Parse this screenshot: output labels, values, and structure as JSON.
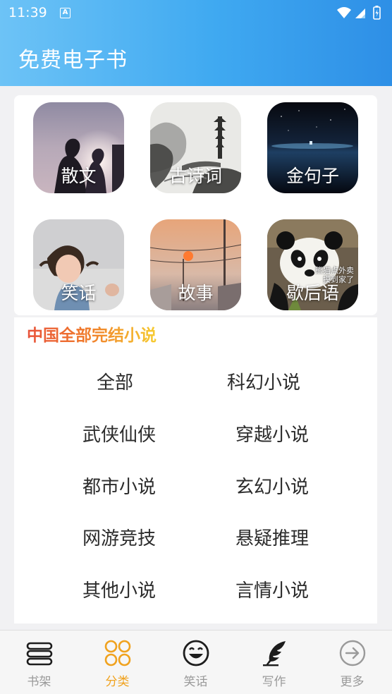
{
  "status_bar": {
    "time": "11:39",
    "notification_icon": "A"
  },
  "app_title": "免费电子书",
  "tiles": [
    {
      "label": "散文",
      "icon": "couple-silhouette-photo"
    },
    {
      "label": "古诗词",
      "icon": "ink-landscape-photo"
    },
    {
      "label": "金句子",
      "icon": "starry-sea-photo"
    },
    {
      "label": "笑话",
      "icon": "girl-laughing-photo"
    },
    {
      "label": "故事",
      "icon": "sunset-street-photo"
    },
    {
      "label": "歇后语",
      "icon": "panda-photo",
      "caption": [
        "熊猫点外卖",
        "摸到家了"
      ]
    }
  ],
  "section": {
    "title": "中国全部完结小说",
    "categories": [
      "全部",
      "科幻小说",
      "武侠仙侠",
      "穿越小说",
      "都市小说",
      "玄幻小说",
      "网游竞技",
      "悬疑推理",
      "其他小说",
      "言情小说"
    ]
  },
  "tabbar": {
    "active": "分类",
    "tabs": [
      {
        "label": "书架",
        "icon": "bookshelf-icon"
      },
      {
        "label": "分类",
        "icon": "category-grid-icon"
      },
      {
        "label": "笑话",
        "icon": "smiley-icon"
      },
      {
        "label": "写作",
        "icon": "feather-pen-icon"
      },
      {
        "label": "更多",
        "icon": "arrow-right-circle-icon"
      }
    ]
  },
  "colors": {
    "header_start": "#6dc3f6",
    "header_end": "#2e8fe6",
    "active_tab": "#f0a21e",
    "inactive_tab": "#9a9a9a"
  }
}
